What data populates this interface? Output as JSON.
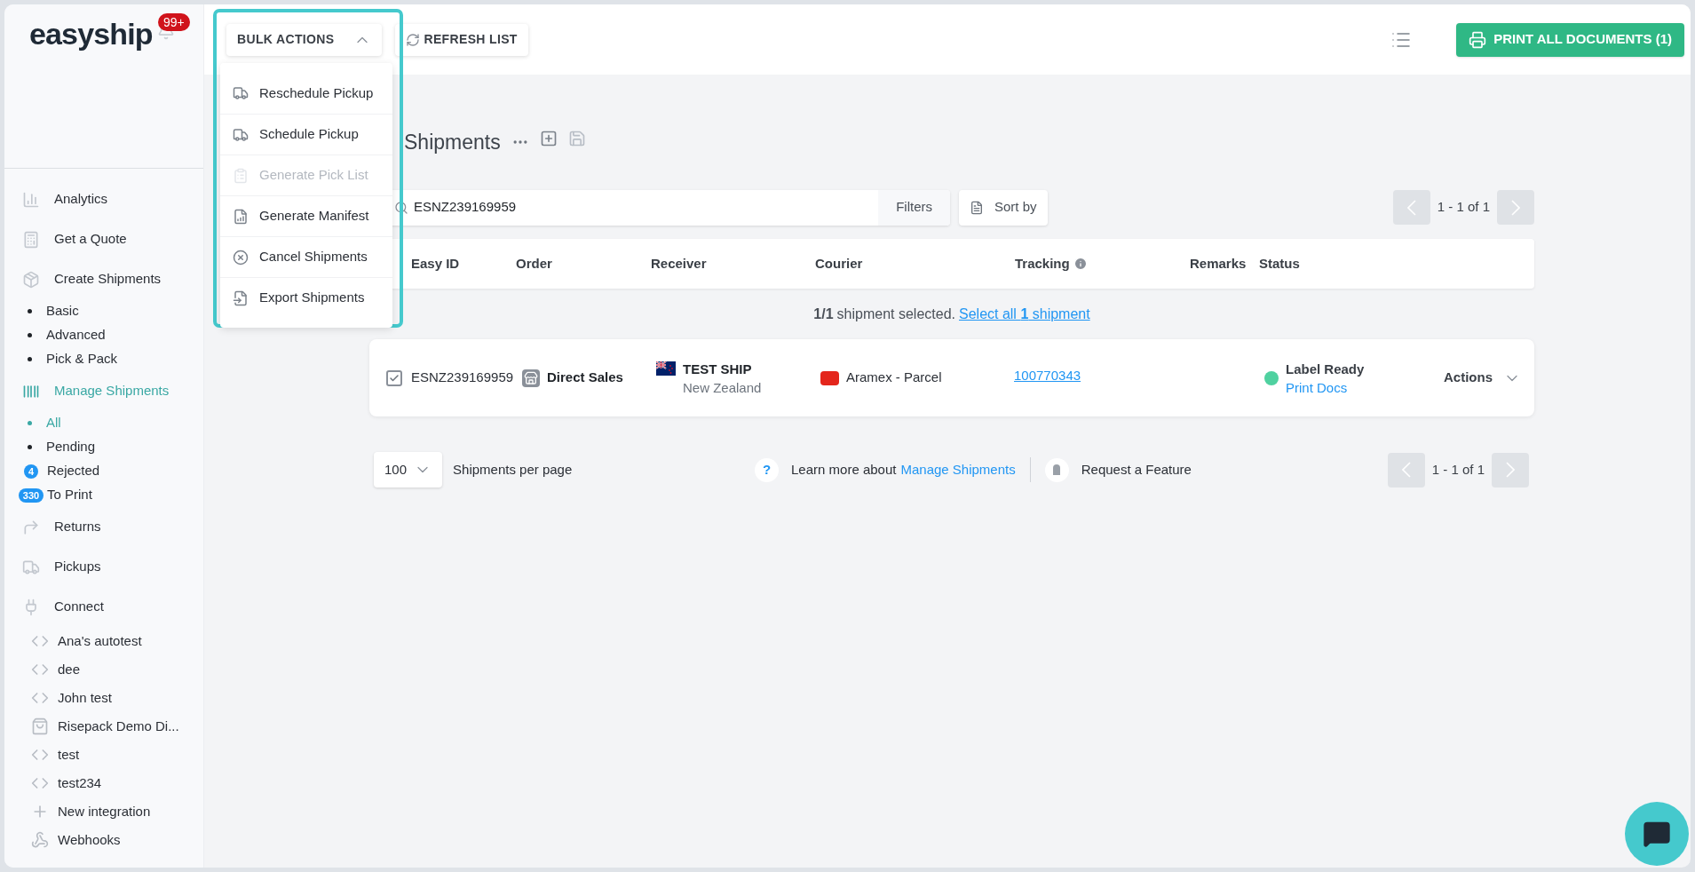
{
  "sidebar": {
    "logo": "easyship",
    "notification_badge": "99+",
    "items": [
      {
        "kind": "nav",
        "label": "Analytics",
        "selected": false
      },
      {
        "kind": "nav",
        "label": "Get a Quote",
        "selected": false
      },
      {
        "kind": "nav",
        "label": "Create Shipments",
        "selected": false
      },
      {
        "kind": "sub",
        "label": "Basic",
        "selected": false
      },
      {
        "kind": "sub",
        "label": "Advanced",
        "selected": false
      },
      {
        "kind": "sub",
        "label": "Pick & Pack",
        "selected": false
      },
      {
        "kind": "nav",
        "label": "Manage Shipments",
        "selected": true
      },
      {
        "kind": "sub",
        "label": "All",
        "selected": true
      },
      {
        "kind": "sub",
        "label": "Pending",
        "selected": false
      },
      {
        "kind": "count",
        "badge": "4",
        "label": "Rejected",
        "selected": false
      },
      {
        "kind": "count",
        "badge": "330",
        "label": "To Print",
        "selected": false
      },
      {
        "kind": "nav",
        "label": "Returns",
        "selected": false
      },
      {
        "kind": "nav",
        "label": "Pickups",
        "selected": false
      },
      {
        "kind": "nav",
        "label": "Connect",
        "selected": false
      },
      {
        "kind": "integration",
        "label": "Ana's autotest"
      },
      {
        "kind": "integration",
        "label": "dee"
      },
      {
        "kind": "integration",
        "label": "John test"
      },
      {
        "kind": "store",
        "label": "Risepack Demo Di..."
      },
      {
        "kind": "integration",
        "label": "test"
      },
      {
        "kind": "integration",
        "label": "test234"
      },
      {
        "kind": "add",
        "label": "New integration"
      },
      {
        "kind": "webhook",
        "label": "Webhooks"
      }
    ]
  },
  "toolbar": {
    "bulk_actions": "BULK ACTIONS",
    "refresh": "REFRESH LIST",
    "print_all": "PRINT ALL DOCUMENTS (1)"
  },
  "bulk_menu": [
    {
      "label": "Reschedule Pickup",
      "disabled": false
    },
    {
      "label": "Schedule Pickup",
      "disabled": false
    },
    {
      "label": "Generate Pick List",
      "disabled": true
    },
    {
      "label": "Generate Manifest",
      "disabled": false
    },
    {
      "label": "Cancel Shipments",
      "disabled": false
    },
    {
      "label": "Export Shipments",
      "disabled": false
    }
  ],
  "page_title": "Shipments",
  "search": {
    "value": "ESNZ239169959",
    "filters": "Filters",
    "sort": "Sort by"
  },
  "pagination": "1 - 1 of 1",
  "table": {
    "columns": [
      "Easy ID",
      "Order",
      "Receiver",
      "Courier",
      "Tracking",
      "Remarks",
      "Status"
    ],
    "selection": {
      "count": "1/1",
      "text": "shipment selected.",
      "link": "Select all **1** shipment"
    },
    "rows": [
      {
        "checked": true,
        "easy_id": "ESNZ239169959",
        "order": "Direct Sales",
        "receiver_name": "TEST SHIP",
        "receiver_country": "New Zealand",
        "courier": "Aramex - Parcel",
        "tracking": "100770343",
        "status": "Label Ready",
        "color": "#4fd1a0",
        "status_link": "Print Docs",
        "actions": "Actions"
      }
    ]
  },
  "footer": {
    "per_page": "100",
    "per_page_label": "Shipments per page",
    "help_icon": "?",
    "learn_more": "Learn more about",
    "learn_more_link": "Manage Shipments",
    "request": "Request a Feature",
    "pagination": "1 - 1 of 1"
  }
}
